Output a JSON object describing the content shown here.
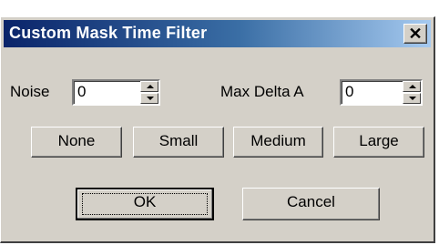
{
  "window": {
    "title": "Custom Mask Time Filter",
    "close_glyph": "✕",
    "close_icon": "close-icon"
  },
  "fields": {
    "noise": {
      "label": "Noise",
      "value": "0"
    },
    "max_delta_a": {
      "label": "Max Delta A",
      "value": "0"
    }
  },
  "presets": {
    "none": "None",
    "small": "Small",
    "medium": "Medium",
    "large": "Large"
  },
  "actions": {
    "ok": "OK",
    "cancel": "Cancel"
  },
  "colors": {
    "dialog_face": "#d4d0c8",
    "titlebar_start": "#0a246a",
    "titlebar_end": "#a6caf0"
  }
}
